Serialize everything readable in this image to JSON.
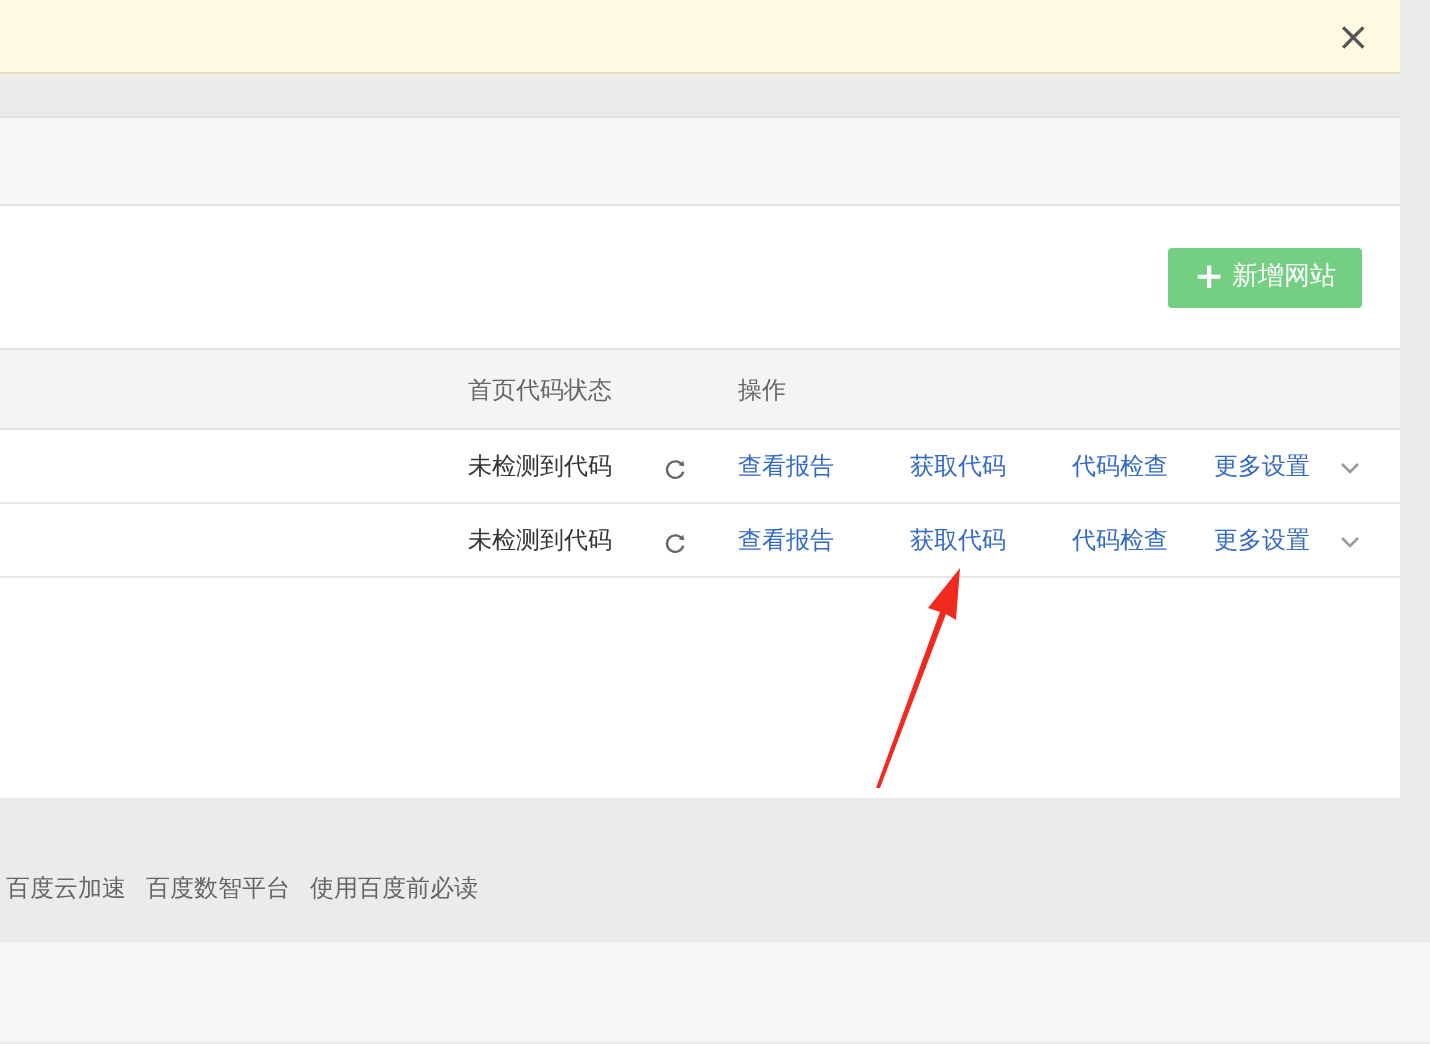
{
  "notice": {
    "close": "×"
  },
  "toolbar": {
    "add_button": "新增网站",
    "add_icon": "+"
  },
  "table": {
    "columns": [
      "首页代码状态",
      "操作"
    ],
    "rows": [
      {
        "status": "未检测到代码",
        "actions": [
          "查看报告",
          "获取代码",
          "代码检查",
          "更多设置"
        ]
      },
      {
        "status": "未检测到代码",
        "actions": [
          "查看报告",
          "获取代码",
          "代码检查",
          "更多设置"
        ]
      }
    ]
  },
  "footer_links": [
    "百度云加速",
    "百度数智平台",
    "使用百度前必读"
  ]
}
